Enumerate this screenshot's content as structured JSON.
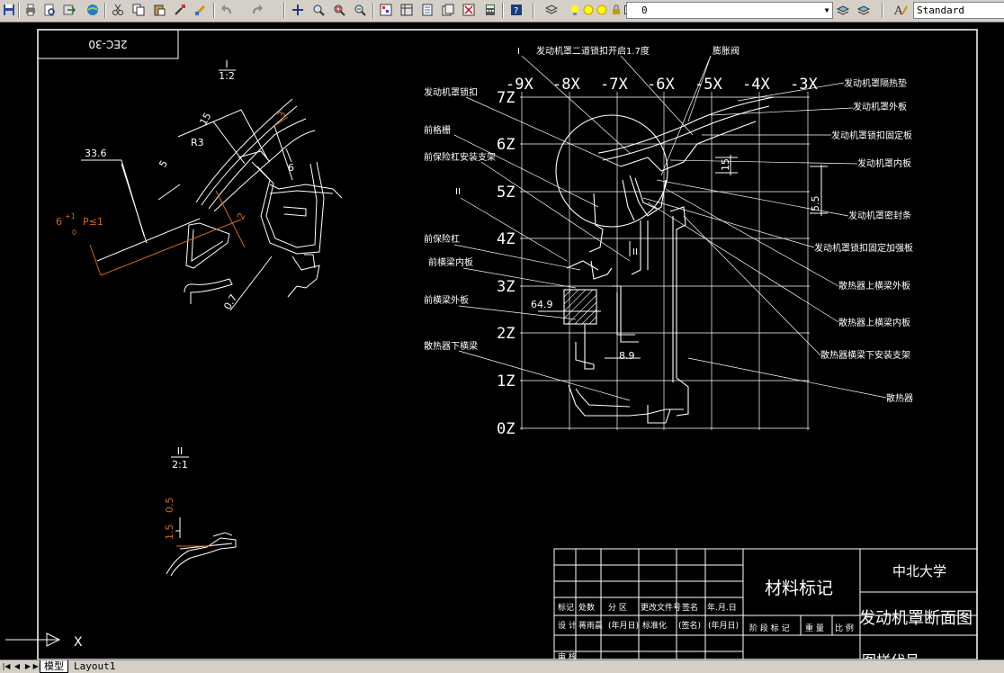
{
  "toolbar": {
    "layer_value": "0",
    "text_style_value": "Standard",
    "icons": [
      "save-icon",
      "print-icon",
      "plot-preview-icon",
      "publish-icon",
      "3d-dwf-icon",
      "cut-icon",
      "copy-icon",
      "paste-icon",
      "match-properties-icon",
      "block-editor-icon",
      "undo-icon",
      "redo-icon",
      "pan-icon",
      "zoom-realtime-icon",
      "zoom-window-icon",
      "zoom-previous-icon",
      "properties-icon",
      "design-center-icon",
      "tool-palettes-icon",
      "sheet-set-icon",
      "markup-icon",
      "calculator-icon",
      "help-icon",
      "layer-manager-icon",
      "layer-state-icon",
      "layer-previous-icon",
      "text-style-icon"
    ]
  },
  "drawing": {
    "title_box_text": "2EC-30",
    "section_labels": {
      "sec1_top": "I",
      "sec1_bottom": "1:2",
      "sec2_top": "II",
      "sec2_bottom": "2:1"
    },
    "dims_left": [
      "33.6",
      "15",
      "R3",
      "5",
      "6",
      "2",
      "3",
      "0.7",
      "1.5",
      "0.5"
    ],
    "tolerance_text": "6",
    "tolerance_super": "+1",
    "tolerance_sub": "0",
    "tolerance_suffix": "P≤1",
    "grid_x": [
      "-9X",
      "-8X",
      "-7X",
      "-6X",
      "-5X",
      "-4X",
      "-3X"
    ],
    "grid_z": [
      "7Z",
      "6Z",
      "5Z",
      "4Z",
      "3Z",
      "2Z",
      "1Z",
      "0Z"
    ],
    "dims_right": [
      "15",
      "5.5",
      "II",
      "64.9",
      "8.9"
    ],
    "callouts_top": [
      "I",
      "发动机罩二道锁扣开启1.7度",
      "膨胀阀"
    ],
    "callouts_left": [
      "发动机罩锁扣",
      "前格栅",
      "前保险杠安装支架",
      "II",
      "前保险杠",
      "前横梁内板",
      "前横梁外板",
      "散热器下横梁"
    ],
    "callouts_right": [
      "发动机罩隔热垫",
      "发动机罩外板",
      "发动机罩锁扣固定板",
      "发动机罩内板",
      "发动机罩密封条",
      "发动机罩锁扣固定加强板",
      "散热器上横梁外板",
      "散热器上横梁内板",
      "散热器横梁下安装支架",
      "散热器"
    ]
  },
  "title_block": {
    "material_label": "材料标记",
    "university": "中北大学",
    "drawing_name": "发动机罩断面图",
    "bottom_partial": "图样代号",
    "row1": [
      "标记",
      "处数",
      "分 区",
      "更改文件号",
      "签名",
      "年.月.日"
    ],
    "row2": [
      "设 计",
      "蒋雨晨",
      "(年月日)",
      "标准化",
      "(签名)",
      "(年月日)"
    ],
    "row3": [
      "审 核"
    ],
    "stage_row": [
      "阶 段 标 记",
      "重 量",
      "比 例"
    ]
  },
  "ucs": {
    "x_label": "X"
  },
  "tabs": [
    "模型",
    "Layout1"
  ]
}
